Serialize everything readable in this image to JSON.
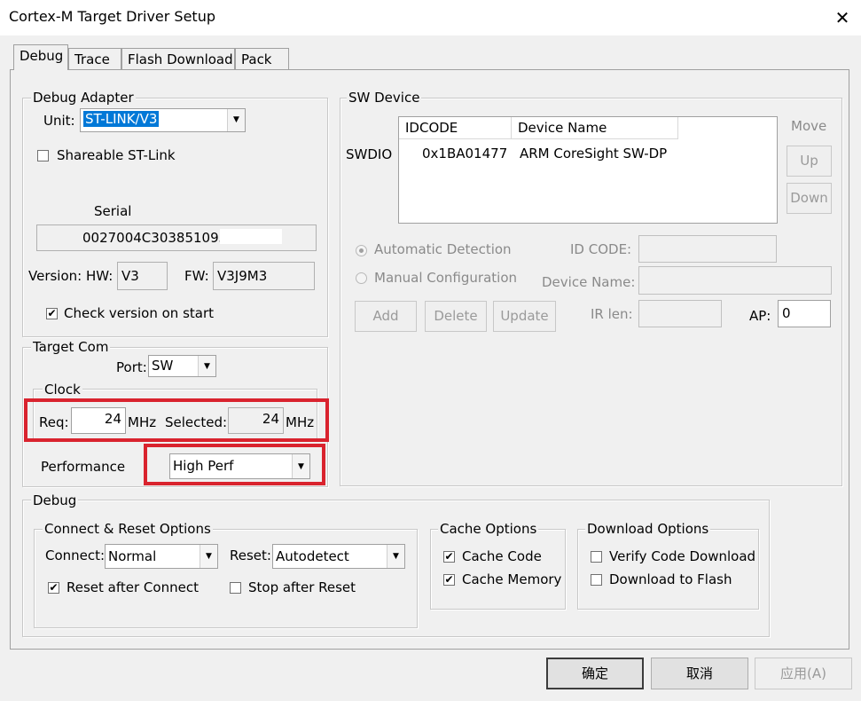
{
  "window": {
    "title": "Cortex-M Target Driver Setup",
    "close_glyph": "✕"
  },
  "tabs": [
    {
      "label": "Debug",
      "active": true
    },
    {
      "label": "Trace"
    },
    {
      "label": "Flash Download"
    },
    {
      "label": "Pack"
    }
  ],
  "debug_adapter": {
    "group_label": "Debug Adapter",
    "unit_label": "Unit:",
    "unit_value": "ST-LINK/V3",
    "shareable_label": "Shareable ST-Link",
    "serial_label": "Serial",
    "serial_value": "0027004C303851093",
    "version_label": "Version: HW:",
    "hw_value": "V3",
    "fw_label": "FW:",
    "fw_value": "V3J9M3",
    "check_version_label": "Check version on start"
  },
  "target_com": {
    "group_label": "Target Com",
    "port_label": "Port:",
    "port_value": "SW",
    "clock_label": "Clock",
    "req_label": "Req:",
    "req_value": "24",
    "req_unit": "MHz",
    "selected_label": "Selected:",
    "selected_value": "24",
    "selected_unit": "MHz",
    "performance_label": "Performance",
    "performance_value": "High Perf"
  },
  "sw_device": {
    "group_label": "SW Device",
    "swdio_label": "SWDIO",
    "columns": [
      "IDCODE",
      "Device Name"
    ],
    "rows": [
      {
        "idcode": "0x1BA01477",
        "device_name": "ARM CoreSight SW-DP"
      }
    ],
    "move_label": "Move",
    "up_label": "Up",
    "down_label": "Down",
    "auto_detect_label": "Automatic Detection",
    "manual_config_label": "Manual Configuration",
    "id_code_label": "ID CODE:",
    "device_name_label": "Device Name:",
    "add_label": "Add",
    "delete_label": "Delete",
    "update_label": "Update",
    "ir_len_label": "IR len:",
    "ap_label": "AP:",
    "ap_value": "0"
  },
  "debug_section": {
    "group_label": "Debug",
    "connect_reset": {
      "group_label": "Connect & Reset Options",
      "connect_label": "Connect:",
      "connect_value": "Normal",
      "reset_label": "Reset:",
      "reset_value": "Autodetect",
      "reset_after_connect": "Reset after Connect",
      "stop_after_reset": "Stop after Reset"
    },
    "cache": {
      "group_label": "Cache Options",
      "cache_code": "Cache Code",
      "cache_memory": "Cache Memory"
    },
    "download": {
      "group_label": "Download Options",
      "verify_code": "Verify Code Download",
      "download_to_flash": "Download to Flash"
    }
  },
  "footer": {
    "ok_label": "确定",
    "cancel_label": "取消",
    "apply_label": "应用(A)"
  },
  "colors": {
    "highlight": "#d9232e",
    "selection": "#0078d7"
  }
}
